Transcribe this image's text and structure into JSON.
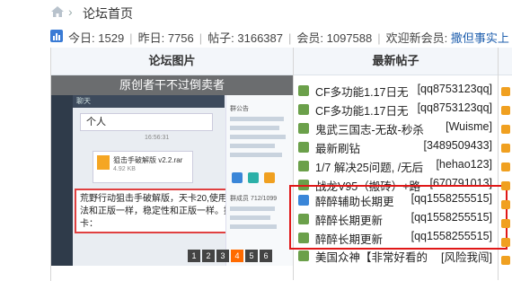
{
  "breadcrumb": {
    "title": "论坛首页"
  },
  "stats": {
    "today_label": "今日:",
    "today_value": "1529",
    "yesterday_label": "昨日:",
    "yesterday_value": "7756",
    "threads_label": "帖子:",
    "threads_value": "3166387",
    "members_label": "会员:",
    "members_value": "1097588",
    "welcome_label": "欢迎新会员:",
    "welcome_user": "撒但事实上"
  },
  "columns": {
    "pics": "论坛图片",
    "latest": "最新帖子"
  },
  "picture": {
    "caption": "原创者干不过倒卖者",
    "chat_title": "聊天",
    "bubble_text": "个人",
    "file_name": "狙击手破解版 v2.2.rar",
    "file_size": "4.92 KB",
    "message": "荒野行动狙击手破解版，天卡20,使用方法和正版一样，稳定性和正版一样。提卡：",
    "time_label": "16:56:31",
    "group_label": "群公告",
    "members_count": "群成员 712/1099",
    "pages": [
      "1",
      "2",
      "3",
      "4",
      "5",
      "6"
    ],
    "active_page": "4"
  },
  "posts": [
    {
      "title": "CF多功能1.17日无",
      "author": "[qq8753123qq]",
      "icon": "green"
    },
    {
      "title": "CF多功能1.17日无",
      "author": "[qq8753123qq]",
      "icon": "green"
    },
    {
      "title": "鬼武三国志-无敌-秒杀",
      "author": "[Wuisme]",
      "icon": "green"
    },
    {
      "title": "最新刷钻",
      "author": "[3489509433]",
      "icon": "green"
    },
    {
      "title": "1/7 解决25问题, /无后",
      "author": "[hehao123]",
      "icon": "green"
    },
    {
      "title": "战龙V95（搬砖）+路",
      "author": "[670791013]",
      "icon": "green"
    },
    {
      "title": "醉醉辅助长期更",
      "author": "[qq1558255515]",
      "icon": "blue"
    },
    {
      "title": "醉醉长期更新",
      "author": "[qq1558255515]",
      "icon": "green"
    },
    {
      "title": "醉醉长期更新",
      "author": "[qq1558255515]",
      "icon": "green"
    },
    {
      "title": "美国众神【非常好看的",
      "author": "[风险我闯]",
      "icon": "green"
    }
  ]
}
